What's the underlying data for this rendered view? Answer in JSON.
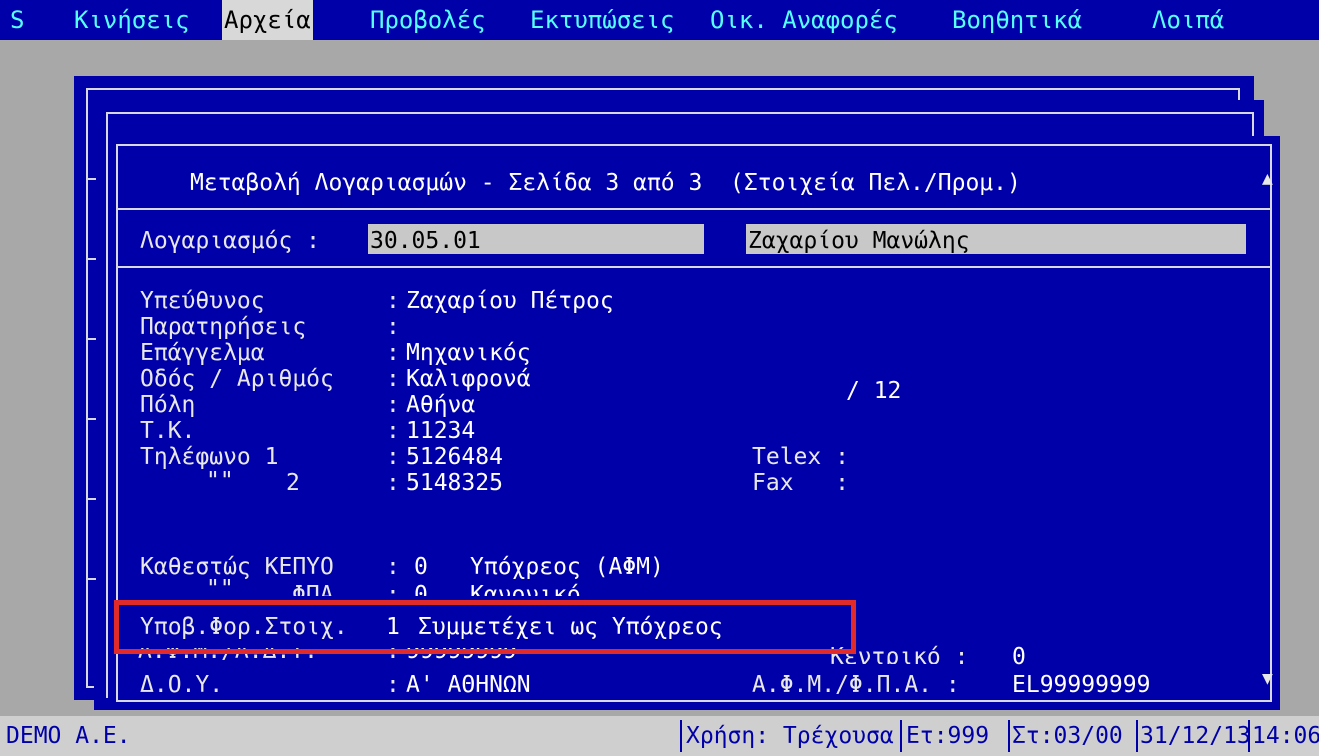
{
  "menu": {
    "items": [
      "S",
      "Κινήσεις",
      "Αρχεία",
      "Προβολές",
      "Εκτυπώσεις",
      "Οικ. Αναφορές",
      "Βοηθητικά",
      "Λοιπά"
    ],
    "active": "Αρχεία"
  },
  "window": {
    "title": "Μεταβολή Λογαριασμών - Σελίδα 3 από 3  (Στοιχεία Πελ./Προμ.)"
  },
  "account": {
    "label": "Λογαριασμός :",
    "code": "30.05.01",
    "name": "Ζαχαρίου Μανώλης"
  },
  "fields": {
    "responsible": {
      "label": "Υπεύθυνος",
      "value": "Ζαχαρίου Πέτρος"
    },
    "remarks": {
      "label": "Παρατηρήσεις",
      "value": ""
    },
    "profession": {
      "label": "Επάγγελμα",
      "value": "Μηχανικός"
    },
    "street": {
      "label": "Οδός / Αριθμός",
      "value": "Καλιφρονά",
      "number": "/ 12"
    },
    "city": {
      "label": "Πόλη",
      "value": "Αθήνα"
    },
    "zip": {
      "label": "Τ.Κ.",
      "value": "11234"
    },
    "phone1": {
      "label": "Τηλέφωνο 1",
      "value": "5126484",
      "side_label": "Telex :"
    },
    "phone2": {
      "label_ditto": "\"\"",
      "label": "2",
      "value": "5148325",
      "side_label": "Fax   :"
    },
    "kepyo": {
      "label": "Καθεστώς ΚΕΠΥΟ",
      "value": "0",
      "desc": "Υπόχρεος (ΑΦΜ)"
    },
    "vat_status": {
      "label_ditto": "\"\"",
      "label": "ΦΠΑ",
      "value": "0",
      "desc": "Κανονικό"
    },
    "submission": {
      "label": "Υποβ.Φορ.Στοιχ.",
      "value": "1",
      "desc": "Συμμετέχει ως Υπόχρεος"
    },
    "afm": {
      "label": "Α.Φ.Μ./Α.Δ.Τ.",
      "value": "99999999",
      "side_label": "Κεντρικό :",
      "side_value": "0"
    },
    "doy": {
      "label": "Δ.Ο.Υ.",
      "value": "Α' ΑΘΗΝΩΝ",
      "side_label": "Α.Φ.Μ./Φ.Π.Α. :",
      "side_value": "EL99999999"
    }
  },
  "status": {
    "company": "DEMO A.E.",
    "fiscal_use": "Χρήση: Τρέχουσα",
    "et": "Ετ:999",
    "st": "Στ:03/00",
    "date": "31/12/13",
    "time": "14:06"
  },
  "icons": {
    "scroll_up": "triangle-up-icon",
    "scroll_down": "triangle-down-icon"
  },
  "colors": {
    "window_bg": "#0000a8",
    "menu_text": "#55ffff",
    "desktop": "#a8a8a8",
    "highlight_box": "#e12a2a"
  }
}
